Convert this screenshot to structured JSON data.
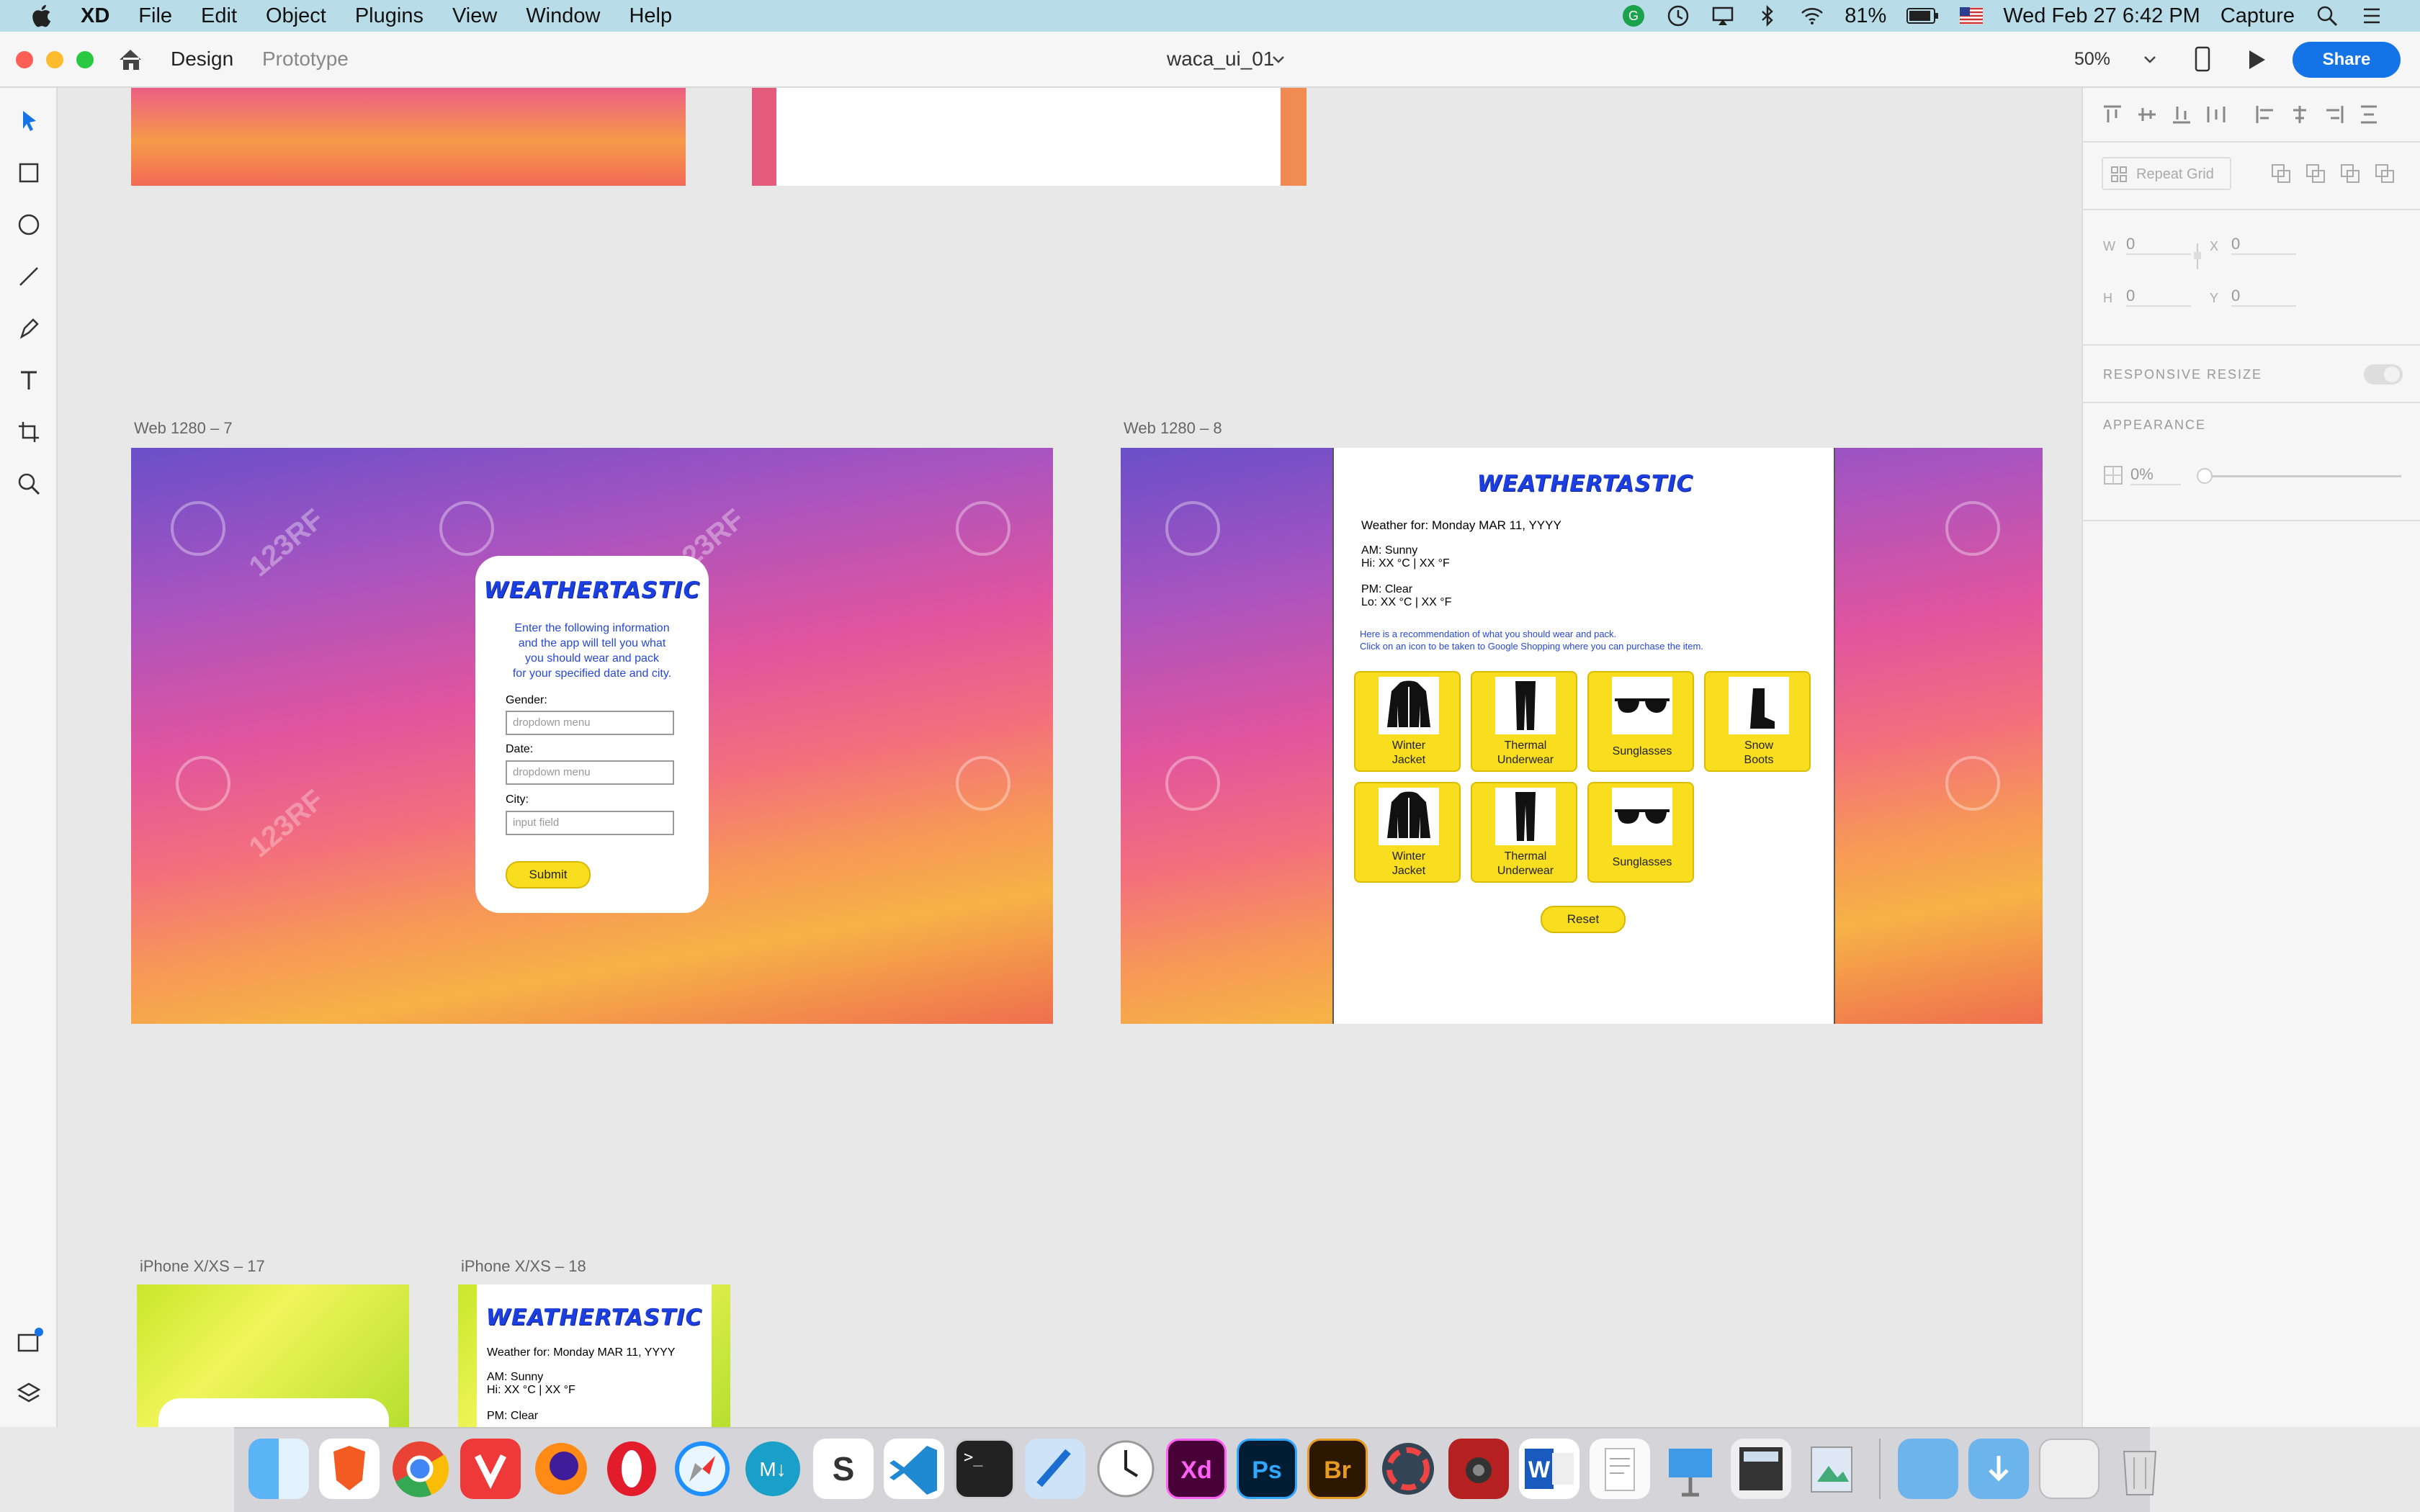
{
  "menubar": {
    "app": "XD",
    "items": [
      "File",
      "Edit",
      "Object",
      "Plugins",
      "View",
      "Window",
      "Help"
    ],
    "battery": "81%",
    "datetime": "Wed Feb 27  6:42 PM",
    "capture": "Capture"
  },
  "titlebar": {
    "tab_design": "Design",
    "tab_prototype": "Prototype",
    "doc_title": "waca_ui_01",
    "zoom": "50%",
    "share": "Share"
  },
  "artboards": {
    "web7_label": "Web 1280 – 7",
    "web8_label": "Web 1280 – 8",
    "iphone17_label": "iPhone X/XS – 17",
    "iphone18_label": "iPhone X/XS – 18"
  },
  "form": {
    "brand": "WEATHERTASTIC",
    "intro_line1": "Enter the following information",
    "intro_line2": "and the app will tell you what",
    "intro_line3": "you should wear and pack",
    "intro_line4": "for your specified date and city.",
    "gender_label": "Gender:",
    "gender_placeholder": "dropdown menu",
    "date_label": "Date:",
    "date_placeholder": "dropdown menu",
    "city_label": "City:",
    "city_placeholder": "input field",
    "submit": "Submit"
  },
  "results": {
    "brand": "WEATHERTASTIC",
    "weather_for": "Weather for: Monday MAR 11, YYYY",
    "am": "AM: Sunny",
    "hi": "Hi: XX °C | XX °F",
    "pm": "PM: Clear",
    "lo": "Lo: XX °C | XX °F",
    "rec_line1": "Here is a recommendation of what you should wear and pack.",
    "rec_line2": "Click on an icon to be taken to Google Shopping where you can purchase the item.",
    "items_row1": [
      {
        "l1": "Winter",
        "l2": "Jacket",
        "icon": "jacket-icon"
      },
      {
        "l1": "Thermal",
        "l2": "Underwear",
        "icon": "underwear-icon"
      },
      {
        "l1": "",
        "l2": "Sunglasses",
        "icon": "sunglasses-icon"
      },
      {
        "l1": "Snow",
        "l2": "Boots",
        "icon": "boot-icon"
      }
    ],
    "items_row2": [
      {
        "l1": "Winter",
        "l2": "Jacket",
        "icon": "jacket-icon"
      },
      {
        "l1": "Thermal",
        "l2": "Underwear",
        "icon": "underwear-icon"
      },
      {
        "l1": "",
        "l2": "Sunglasses",
        "icon": "sunglasses-icon"
      }
    ],
    "reset": "Reset"
  },
  "mobile": {
    "brand": "WEATHERTASTIC",
    "weather_for": "Weather for: Monday MAR 11, YYYY",
    "am": "AM: Sunny",
    "hi": "Hi: XX °C | XX °F",
    "pm": "PM: Clear"
  },
  "panel": {
    "repeat_grid": "Repeat Grid",
    "w_label": "W",
    "w_value": "0",
    "x_label": "X",
    "x_value": "0",
    "h_label": "H",
    "h_value": "0",
    "y_label": "Y",
    "y_value": "0",
    "responsive_resize": "RESPONSIVE RESIZE",
    "appearance": "APPEARANCE",
    "opacity": "0%"
  },
  "watermark": "123RF",
  "colors": {
    "accent": "#1473e6",
    "brand_blue": "#1b3fe0",
    "yellow": "#f8de1f"
  }
}
